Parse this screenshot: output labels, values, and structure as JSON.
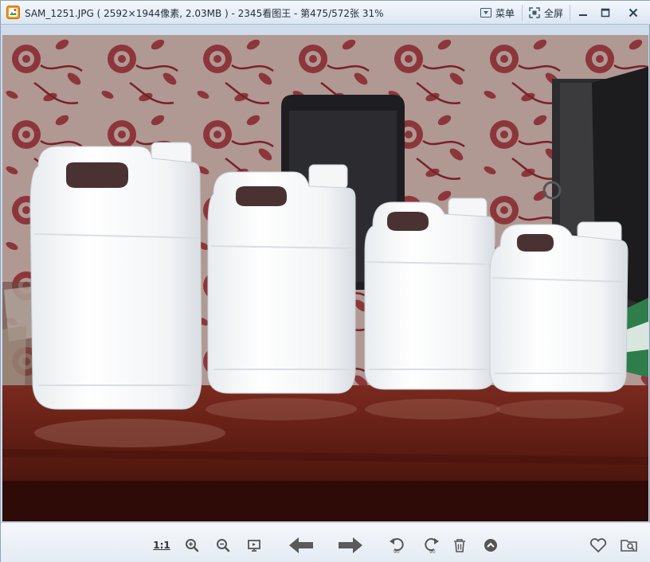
{
  "window": {
    "title": "SAM_1251.JPG ( 2592×1944像素, 2.03MB ) - 2345看图王 - 第475/572张 31%"
  },
  "titlebar": {
    "menu_label": "菜单",
    "fullscreen_label": "全屏"
  },
  "icons": {
    "app": "app-logo-icon",
    "menu": "menu-dropdown-icon",
    "fullscreen": "fullscreen-icon",
    "minimize": "minimize-icon",
    "maximize": "maximize-icon",
    "close": "close-icon",
    "zoom_in": "zoom-in-icon",
    "zoom_out": "zoom-out-icon",
    "fit": "fit-window-icon",
    "prev": "arrow-left-icon",
    "next": "arrow-right-icon",
    "rotate_left": "rotate-left-icon",
    "rotate_right": "rotate-right-icon",
    "delete": "trash-icon",
    "more": "chevron-up-icon",
    "favorite": "heart-icon",
    "folder": "folder-search-icon"
  },
  "toolbar": {
    "actual_size_label": "1:1",
    "rotate_left_badge": "90",
    "rotate_right_badge": "90"
  },
  "colors": {
    "accent": "#2b6fb5",
    "toolbar_icon": "#555555",
    "wallpaper": "#c9b2ae",
    "table": "#5a1e16"
  }
}
